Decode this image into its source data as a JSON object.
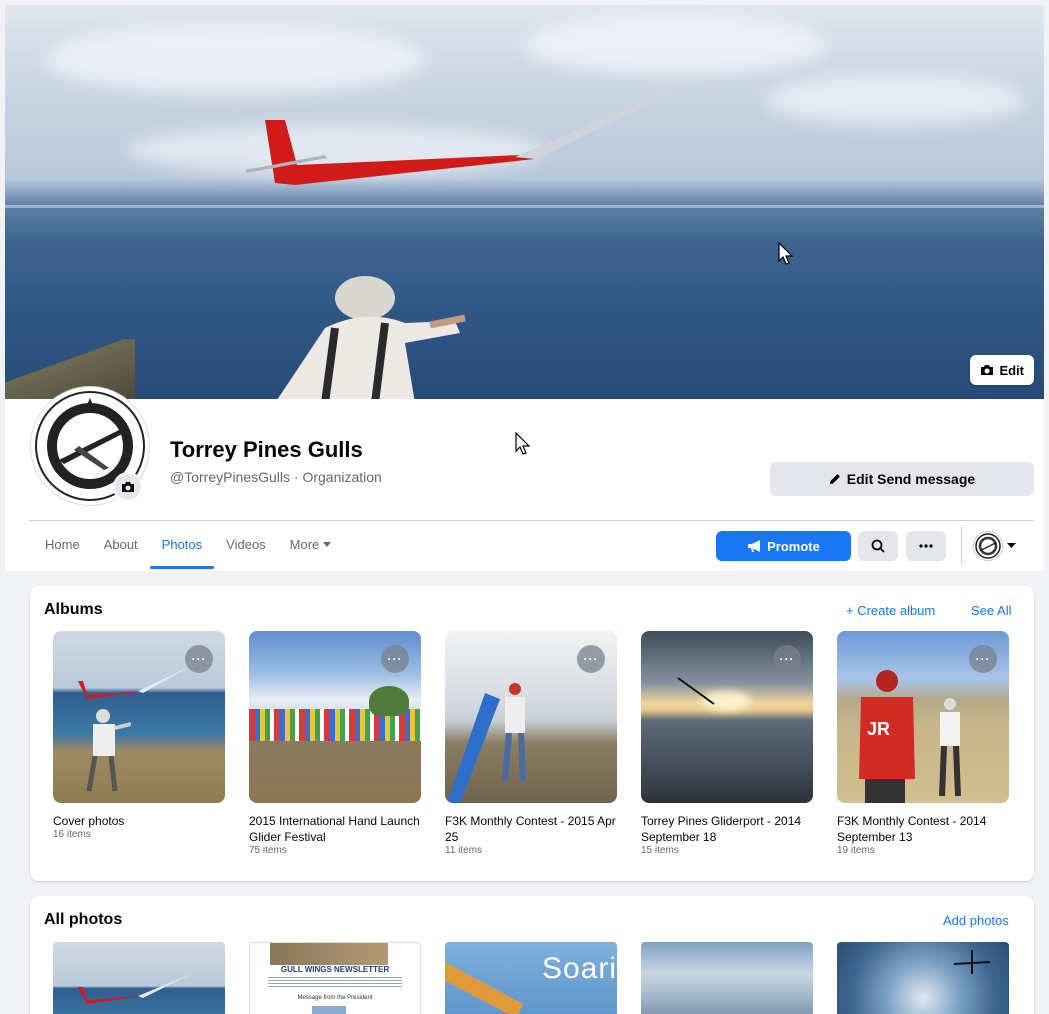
{
  "cover": {
    "edit_label": "Edit"
  },
  "page": {
    "name": "Torrey Pines Gulls",
    "subtitle": "@TorreyPinesGulls · Organization",
    "edit_send_label": "Edit Send message"
  },
  "nav": {
    "tabs": [
      {
        "label": "Home"
      },
      {
        "label": "About"
      },
      {
        "label": "Photos"
      },
      {
        "label": "Videos"
      },
      {
        "label": "More"
      }
    ],
    "active_tab": "Photos",
    "promote_label": "Promote"
  },
  "albums": {
    "title": "Albums",
    "create_label": "+ Create album",
    "see_all_label": "See All",
    "items": [
      {
        "name": "Cover photos",
        "count": "16 items"
      },
      {
        "name": "2015 International Hand Launch Glider Festival",
        "count": "75 items"
      },
      {
        "name": "F3K Monthly Contest - 2015 Apr 25",
        "count": "11 items"
      },
      {
        "name": "Torrey Pines Gliderport - 2014 September 18",
        "count": "15 items"
      },
      {
        "name": "F3K Monthly Contest - 2014 September 13",
        "count": "19 items"
      }
    ]
  },
  "all_photos": {
    "title": "All photos",
    "add_label": "Add photos",
    "newsletter_title": "GULL WINGS NEWSLETTER",
    "newsletter_sub": "Message from the President",
    "magazine_title": "Soari"
  },
  "colors": {
    "accent": "#1877f2",
    "secondary_bg": "#e4e6eb",
    "page_bg": "#f0f2f5"
  }
}
